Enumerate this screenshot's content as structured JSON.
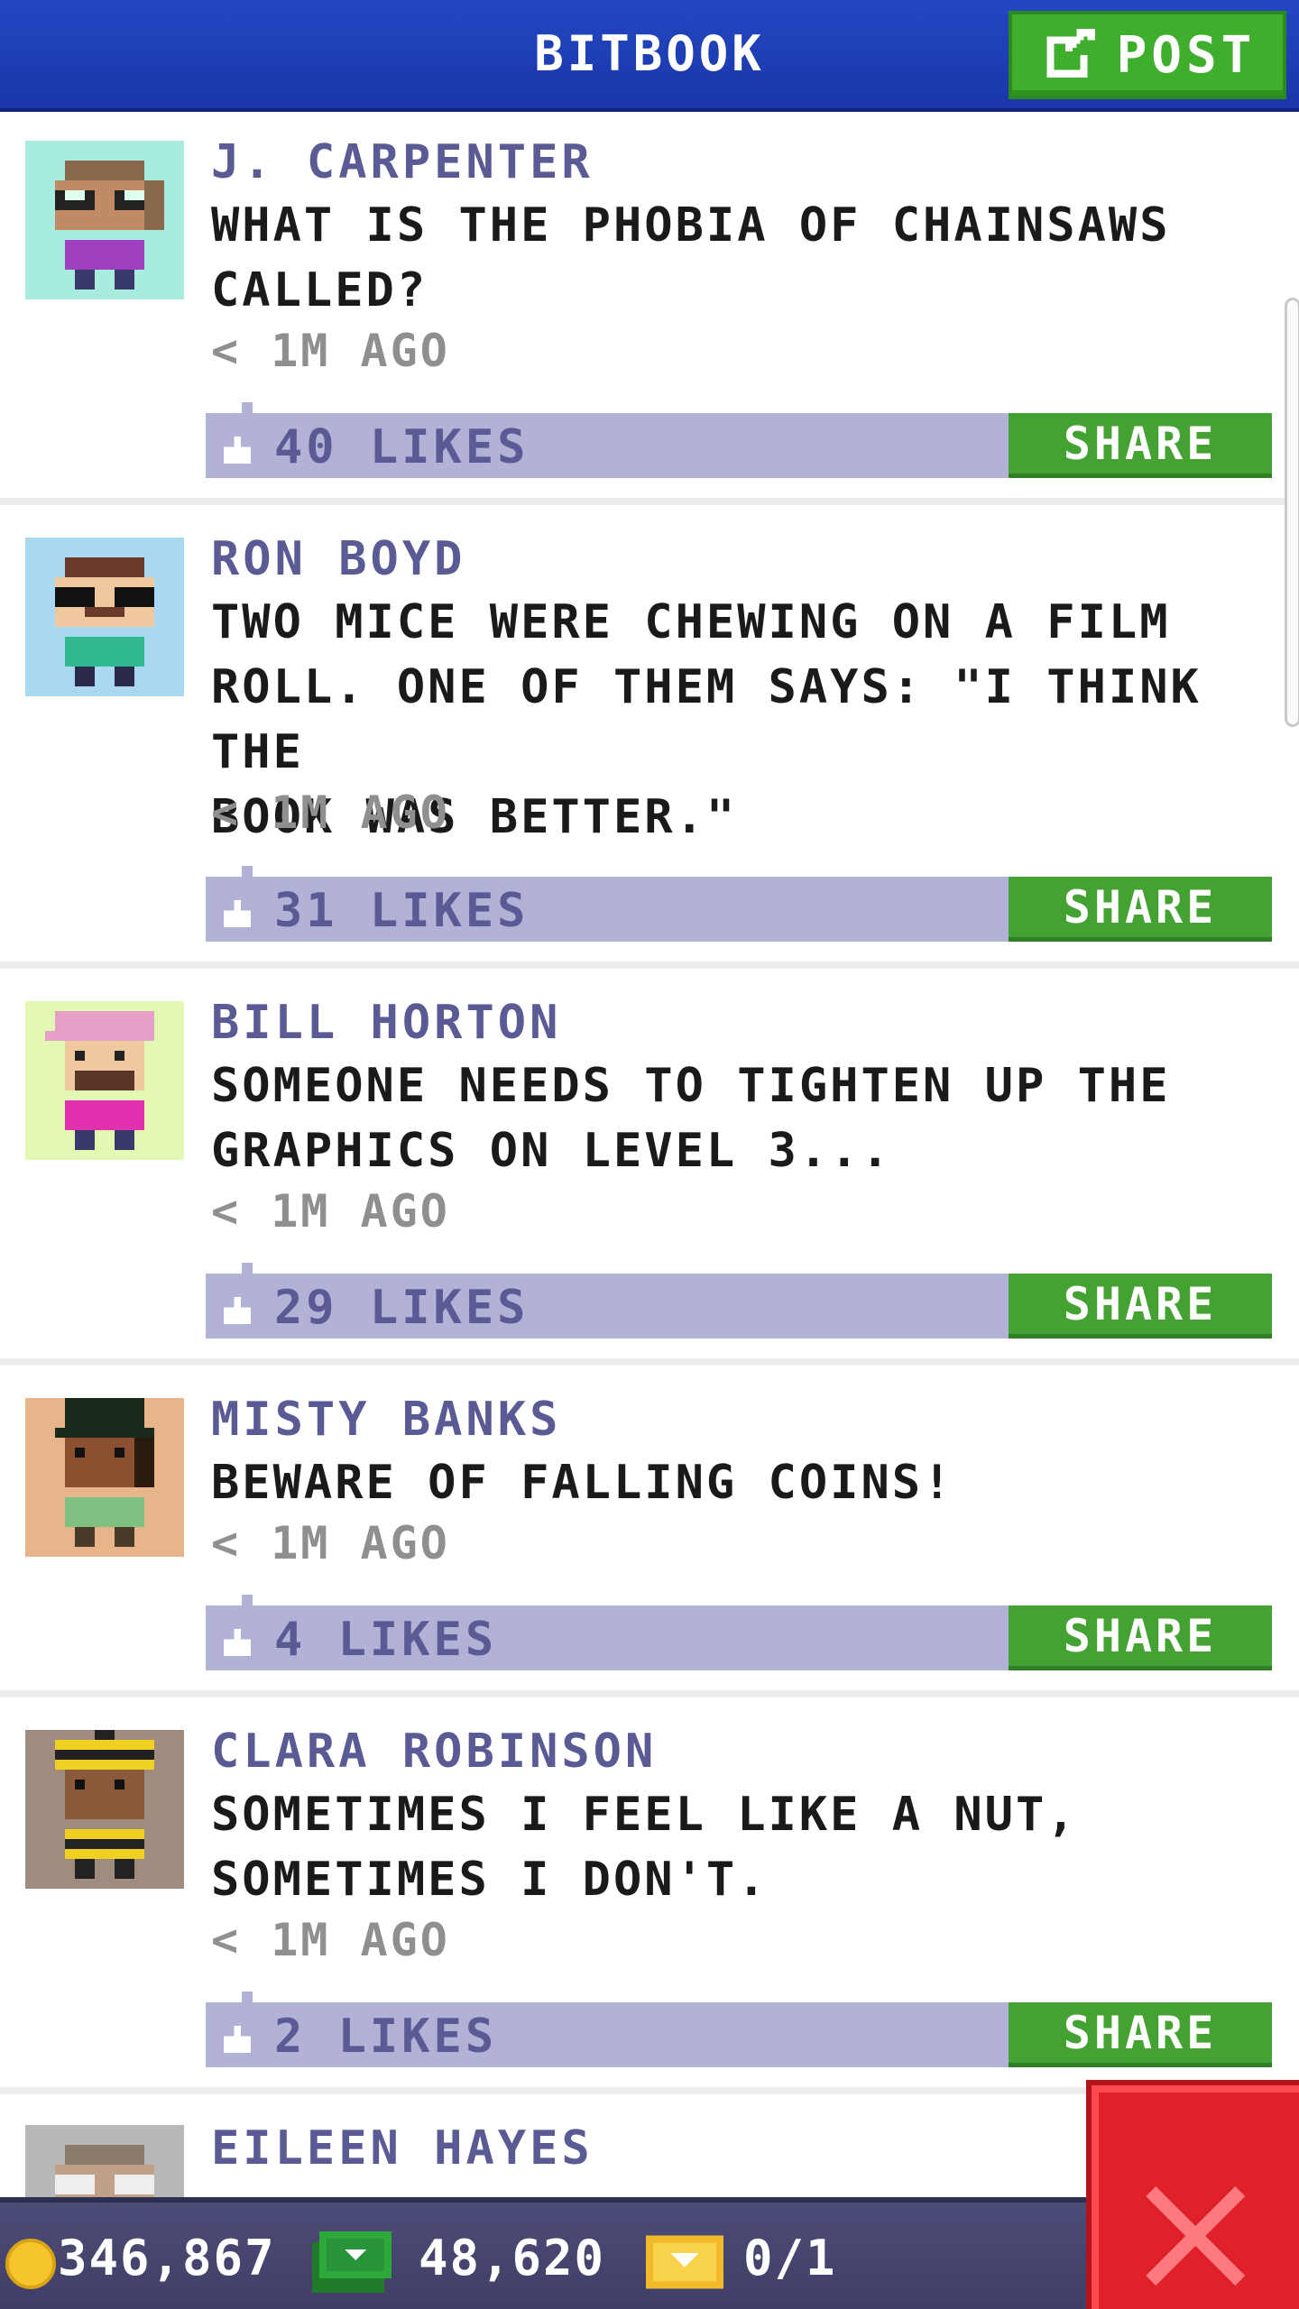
{
  "header": {
    "title": "BITBOOK",
    "post_label": "POST",
    "post_icon": "edit-icon",
    "bg_color": "#1f3fb8",
    "post_color": "#3fae2c"
  },
  "feed": [
    {
      "author": "J. CARPENTER",
      "message": "WHAT IS THE PHOBIA OF CHAINSAWS\nCALLED?",
      "time": "< 1M AGO",
      "likes": "40 LIKES",
      "share_label": "SHARE",
      "avatar_bg": "#a8ece0"
    },
    {
      "author": "RON BOYD",
      "message": "TWO MICE WERE CHEWING ON A FILM\nROLL. ONE OF THEM SAYS: \"I THINK THE\nBOOK WAS BETTER.\"",
      "time": "< 1M AGO",
      "likes": "31 LIKES",
      "share_label": "SHARE",
      "avatar_bg": "#a9d8f0"
    },
    {
      "author": "BILL HORTON",
      "message": "SOMEONE NEEDS TO TIGHTEN UP THE\nGRAPHICS ON LEVEL 3...",
      "time": "< 1M AGO",
      "likes": "29 LIKES",
      "share_label": "SHARE",
      "avatar_bg": "#e2f8b3"
    },
    {
      "author": "MISTY BANKS",
      "message": "BEWARE OF FALLING COINS!",
      "time": "< 1M AGO",
      "likes": "4 LIKES",
      "share_label": "SHARE",
      "avatar_bg": "#e8b48a"
    },
    {
      "author": "CLARA ROBINSON",
      "message": "SOMETIMES I FEEL LIKE A NUT,\nSOMETIMES I DON'T.",
      "time": "< 1M AGO",
      "likes": "2 LIKES",
      "share_label": "SHARE",
      "avatar_bg": "#a08c7e"
    },
    {
      "author": "EILEEN HAYES",
      "message": "",
      "time": "",
      "likes": "",
      "share_label": "",
      "avatar_bg": "#b8b8b8"
    }
  ],
  "status_bar": {
    "coins": "346,867",
    "bux": "48,620",
    "tickets": "0/1",
    "coin_icon": "coin-icon",
    "bux_icon": "cash-icon",
    "ticket_icon": "ticket-icon"
  },
  "close_button": {
    "icon": "close-icon",
    "color": "#e1212a"
  }
}
